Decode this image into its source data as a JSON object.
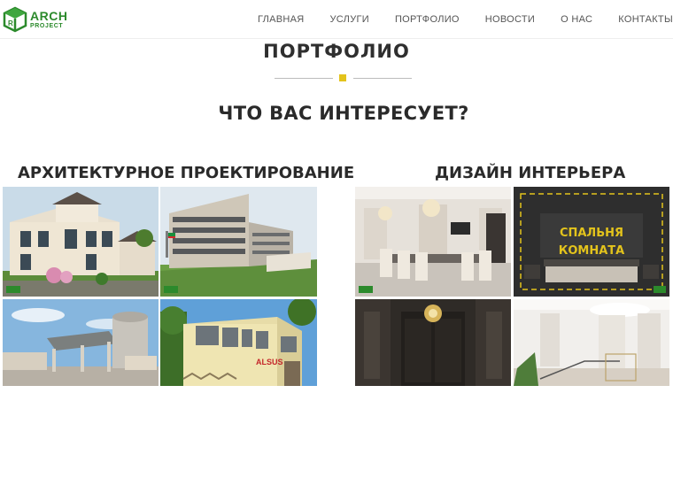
{
  "logo": {
    "main": "ARCH",
    "sub": "PROJECT"
  },
  "nav": {
    "items": [
      {
        "label": "ГЛАВНАЯ"
      },
      {
        "label": "УСЛУГИ"
      },
      {
        "label": "ПОРТФОЛИО"
      },
      {
        "label": "НОВОСТИ"
      },
      {
        "label": "О НАС"
      },
      {
        "label": "КОНТАКТЫ"
      }
    ]
  },
  "portfolio": {
    "title": "ПОРТФОЛИО",
    "subtitle": "ЧТО ВАС ИНТЕРЕСУЕТ?",
    "categories": [
      {
        "title": "АРХИТЕКТУРНОЕ ПРОЕКТИРОВАНИЕ"
      },
      {
        "title": "ДИЗАЙН ИНТЕРЬЕРА"
      }
    ],
    "interior_sign": {
      "line1": "СПАЛЬНЯ",
      "line2": "КОМНАТА"
    },
    "building_sign": "ALSUS"
  },
  "colors": {
    "accent": "#e3c31c",
    "brand": "#2c8a2c"
  }
}
